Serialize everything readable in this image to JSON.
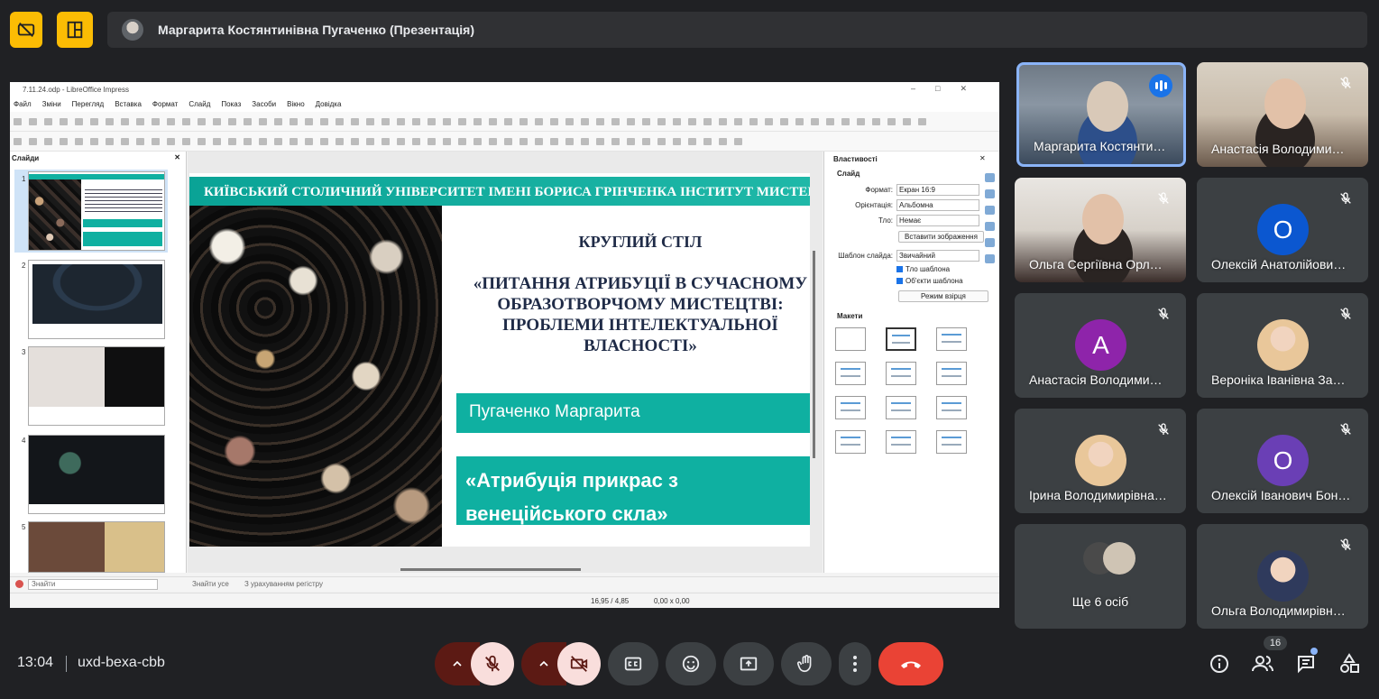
{
  "presenter": {
    "name": "Маргарита Костянтинівна Пугаченко (Презентація)"
  },
  "impress": {
    "window_title": "7.11.24.odp - LibreOffice Impress",
    "menu": [
      "Файл",
      "Зміни",
      "Перегляд",
      "Вставка",
      "Формат",
      "Слайд",
      "Показ",
      "Засоби",
      "Вікно",
      "Довідка"
    ],
    "slides_panel_title": "Слайди",
    "slide_numbers": [
      "1",
      "2",
      "3",
      "4",
      "5"
    ],
    "slide": {
      "header": "КИЇВСЬКИЙ СТОЛИЧНИЙ УНІВЕРСИТЕТ ІМЕНІ БОРИСА ГРІНЧЕНКА ІНСТИТУТ МИСТЕЦТВ",
      "title": "КРУГЛИЙ СТІЛ",
      "subtitle": "«ПИТАННЯ АТРИБУЦІЇ В СУЧАСНОМУ ОБРАЗОТВОРЧОМУ МИСТЕЦТВІ: ПРОБЛЕМИ ІНТЕЛЕКТУАЛЬНОЇ ВЛАСНОСТІ»",
      "author": "Пугаченко Маргарита",
      "topic": "«Атрибуція прикрас з венеційського скла»"
    },
    "properties": {
      "title": "Властивості",
      "section_slide": "Слайд",
      "format_label": "Формат:",
      "format_value": "Екран 16:9",
      "orientation_label": "Орієнтація:",
      "orientation_value": "Альбомна",
      "background_label": "Тло:",
      "background_value": "Немає",
      "insert_image_button": "Вставити зображення",
      "master_label": "Шаблон слайда:",
      "master_value": "Звичайний",
      "master_bg_checkbox": "Тло шаблона",
      "master_objects_checkbox": "Об'єкти шаблона",
      "master_mode_button": "Режим взірця",
      "section_layouts": "Макети"
    },
    "find": {
      "placeholder": "Знайти",
      "find_all": "Знайти усе",
      "match_case": "З урахуванням регістру"
    },
    "status": {
      "position": "16,95 / 4,85",
      "size": "0,00 x 0,00"
    }
  },
  "participants": [
    {
      "name": "Маргарита Костянти…",
      "speaking": true,
      "active": true
    },
    {
      "name": "Анастасія Володими…",
      "muted": true
    },
    {
      "name": "Ольга Сергіївна Орл…",
      "muted": true
    },
    {
      "name": "Олексій Анатолійови…",
      "muted": true,
      "initial": "О",
      "color": "#0b57d0"
    },
    {
      "name": "Анастасія Володими…",
      "muted": true,
      "initial": "А",
      "color": "#8e24aa"
    },
    {
      "name": "Вероніка Іванівна За…",
      "muted": true
    },
    {
      "name": "Ірина Володимирівна…",
      "muted": true
    },
    {
      "name": "Олексій Іванович Бон…",
      "muted": true,
      "initial": "О",
      "color": "#6a3fb5"
    },
    {
      "name": "Ще 6 осіб"
    },
    {
      "name": "Ольга Володимирівн…",
      "muted": true
    }
  ],
  "bottom": {
    "time": "13:04",
    "meeting_code": "uxd-bexa-cbb",
    "people_count": "16"
  },
  "colors": {
    "background": "#202124",
    "danger": "#ea4335",
    "muted_button": "#f9dedc",
    "accent_yellow": "#fbbc04",
    "teal": "#0fb0a1"
  }
}
